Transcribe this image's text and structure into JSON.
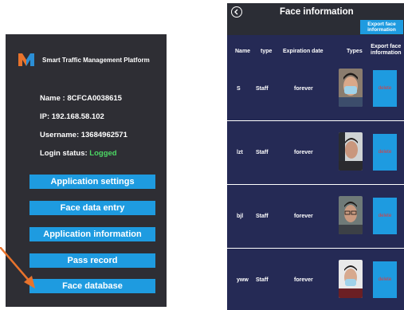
{
  "app": {
    "title": "Smart Traffic Management Platform"
  },
  "device": {
    "name_label": "Name : 8CFCA0038615",
    "ip_label": "IP: 192.168.58.102",
    "username_label": "Username: 13684962571",
    "login_status_prefix": "Login status: ",
    "login_status_value": "Logged"
  },
  "menu": [
    "Application settings",
    "Face data entry",
    "Application information",
    "Pass record",
    "Face database"
  ],
  "face_info": {
    "title": "Face information",
    "export_button_line1": "Export face",
    "export_button_line2": "information",
    "columns": {
      "name": "Name",
      "type": "type",
      "expiration": "Expiration date",
      "types": "Types",
      "export_line1": "Export face",
      "export_line2": "information"
    },
    "rows": [
      {
        "name": "S",
        "type": "Staff",
        "expiration": "forever",
        "action": "delete"
      },
      {
        "name": "lzt",
        "type": "Staff",
        "expiration": "forever",
        "action": "delete"
      },
      {
        "name": "bjl",
        "type": "Staff",
        "expiration": "forever",
        "action": "delete"
      },
      {
        "name": "yww",
        "type": "Staff",
        "expiration": "forever",
        "action": "delete"
      }
    ]
  },
  "colors": {
    "left_bg": "#2e2e34",
    "right_bg": "#252a55",
    "button": "#1e9be0",
    "logged": "#4cd964",
    "arrow": "#e8732c",
    "delete_text": "#e23a3a"
  },
  "icons": {
    "back": "back-circle-icon",
    "logo": "m-logo-icon",
    "pointer": "arrow-icon"
  }
}
